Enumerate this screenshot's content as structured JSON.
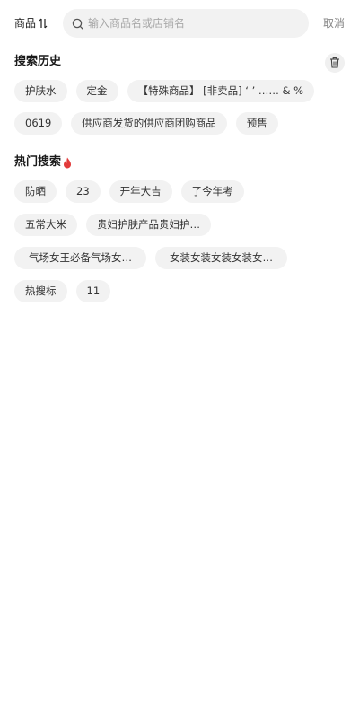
{
  "header": {
    "scope_label": "商品",
    "scope_icon": "swap-vertical-icon",
    "search_icon": "search-icon",
    "search_placeholder": "输入商品名或店铺名",
    "search_value": "",
    "cancel_label": "取消"
  },
  "history": {
    "title": "搜索历史",
    "clear_icon": "trash-icon",
    "items": [
      "护肤水",
      "定金",
      "【特殊商品】 [非卖品] ‘ ’ …… & %",
      "0619",
      "供应商发货的供应商团购商品",
      "预售"
    ]
  },
  "hot": {
    "title": "热门搜索",
    "title_icon": "fire-icon",
    "accent_color": "#e23b3b",
    "items": [
      "防晒",
      "23",
      "开年大吉",
      "了今年考",
      "五常大米",
      "贵妇护肤产品贵妇护…",
      "气场女王必备气场女…",
      "女装女装女装女装女…",
      "热搜标",
      "11"
    ]
  },
  "colors": {
    "chip_bg": "#f2f2f2",
    "search_bg": "#f2f2f2",
    "muted_text": "#888888",
    "placeholder_text": "#a8a8a8"
  }
}
